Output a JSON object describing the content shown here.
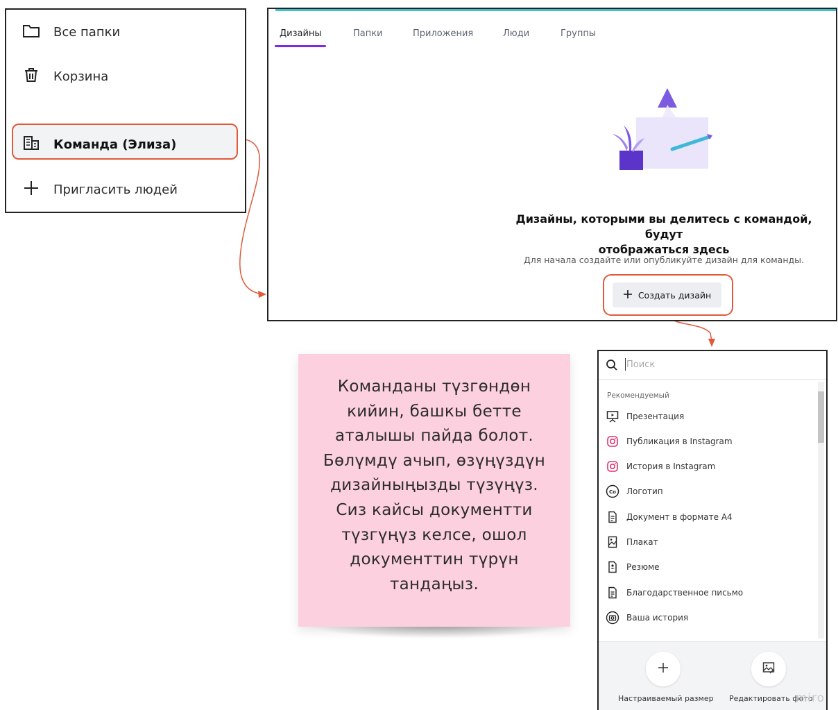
{
  "sidebar": {
    "items": [
      {
        "label": "Все папки",
        "icon": "folder-icon"
      },
      {
        "label": "Корзина",
        "icon": "trash-icon"
      },
      {
        "label": "Команда (Элиза)",
        "icon": "team-building-icon",
        "active": true
      },
      {
        "label": "Пригласить людей",
        "icon": "plus-icon"
      }
    ]
  },
  "main": {
    "tabs": [
      "Дизайны",
      "Папки",
      "Приложения",
      "Люди",
      "Группы"
    ],
    "active_tab": "Дизайны",
    "empty_title_line1": "Дизайны, которыми вы делитесь с командой, будут",
    "empty_title_line2": "отображаться здесь",
    "empty_subtitle": "Для начала создайте или опубликуйте дизайн для команды.",
    "create_button": "Создать дизайн"
  },
  "note": {
    "lines": [
      "Команданы түзгөндөн",
      "кийин, башкы бетте",
      "аталышы пайда болот.",
      "Бөлүмдү ачып, өзүңүздүн",
      "дизайныңызды түзүңүз.",
      "Сиз кайсы документти",
      "түзгүңүз келсе, ошол",
      "документтин түрүн",
      "тандаңыз."
    ]
  },
  "dropdown": {
    "search_placeholder": "Поиск",
    "section_label": "Рекомендуемый",
    "items": [
      {
        "label": "Презентация",
        "icon": "presentation-icon"
      },
      {
        "label": "Публикация в Instagram",
        "icon": "instagram-icon"
      },
      {
        "label": "История в Instagram",
        "icon": "instagram-icon"
      },
      {
        "label": "Логотип",
        "icon": "logo-icon"
      },
      {
        "label": "Документ в формате A4",
        "icon": "document-icon"
      },
      {
        "label": "Плакат",
        "icon": "poster-icon"
      },
      {
        "label": "Резюме",
        "icon": "resume-icon"
      },
      {
        "label": "Благодарственное письмо",
        "icon": "letter-icon"
      },
      {
        "label": "Ваша история",
        "icon": "camera-icon"
      }
    ],
    "footer": {
      "custom_size": "Настраиваемый размер",
      "edit_photo": "Редактировать фото"
    },
    "watermark": "miro"
  },
  "colors": {
    "accent": "#7d2ae8",
    "highlight": "#e0593a",
    "note": "#fcd0de",
    "instagram": "#e1306c"
  }
}
